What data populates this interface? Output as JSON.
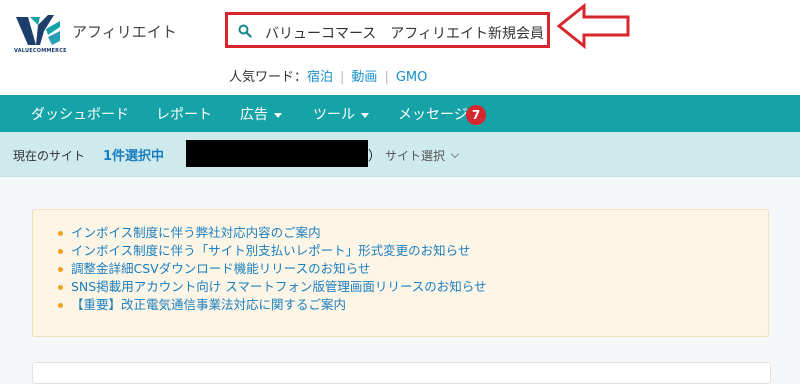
{
  "header": {
    "logo_text": "VALUECOMMERCE",
    "app_title": "アフィリエイト",
    "search": {
      "value": "バリューコマース　アフィリエイト新規会員"
    },
    "popular": {
      "label": "人気ワード：",
      "keywords": [
        "宿泊",
        "動画",
        "GMO"
      ]
    }
  },
  "nav": {
    "items": [
      "ダッシュボード",
      "レポート",
      "広告",
      "ツール",
      "メッセージ"
    ],
    "message_badge": "7"
  },
  "sitebar": {
    "label": "現在のサイト",
    "count": "1件選択中",
    "paren_open": "（",
    "paren_close": "）",
    "select_label": "サイト選択"
  },
  "notices": [
    "インボイス制度に伴う弊社対応内容のご案内",
    "インボイス制度に伴う「サイト別支払いレポート」形式変更のお知らせ",
    "調整金詳細CSVダウンロード機能リリースのお知らせ",
    "SNS掲載用アカウント向け スマートフォン版管理画面リリースのお知らせ",
    "【重要】改正電気通信事業法対応に関するご案内"
  ],
  "colors": {
    "nav_bg": "#15a3a8",
    "sitebar_bg": "#cfeaec",
    "link": "#1a7fc0",
    "highlight": "#d9262d",
    "notice_bg": "#fdf5e6"
  }
}
